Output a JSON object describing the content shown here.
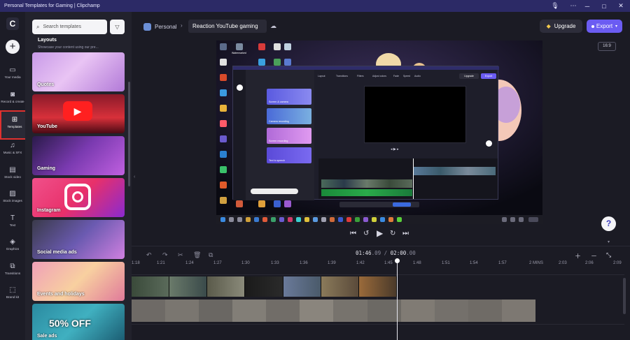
{
  "window": {
    "title": "Personal Templates for Gaming | Clipchamp",
    "controls": [
      "🎙",
      "⋯",
      "─",
      "□",
      "✕"
    ]
  },
  "nav": {
    "logo_letter": "C",
    "create_symbol": "+",
    "items": [
      {
        "label": "Your media",
        "icon": "folder-icon",
        "glyph": "▭"
      },
      {
        "label": "Record & create",
        "icon": "camera-icon",
        "glyph": "◙"
      },
      {
        "label": "Templates",
        "icon": "templates-icon",
        "glyph": "⊞",
        "active": true
      },
      {
        "label": "Music & SFX",
        "icon": "music-icon",
        "glyph": "♫"
      },
      {
        "label": "Stock video",
        "icon": "film-icon",
        "glyph": "▤"
      },
      {
        "label": "Stock images",
        "icon": "image-icon",
        "glyph": "▨"
      },
      {
        "label": "Text",
        "icon": "text-icon",
        "glyph": "T"
      },
      {
        "label": "Graphics",
        "icon": "shapes-icon",
        "glyph": "◈"
      },
      {
        "label": "Transitions",
        "icon": "transitions-icon",
        "glyph": "⧉"
      },
      {
        "label": "Brand kit",
        "icon": "brand-kit-icon",
        "glyph": "⬚"
      }
    ]
  },
  "templates_panel": {
    "search_placeholder": "Search templates",
    "section_title": "Layouts",
    "section_subtitle": "Showcase your content using our pre...",
    "cards": [
      {
        "label": "Quotes"
      },
      {
        "label": "YouTube"
      },
      {
        "label": "Gaming"
      },
      {
        "label": "Instagram"
      },
      {
        "label": "Social media ads"
      },
      {
        "label": "Events and holidays"
      },
      {
        "label": "Sale ads",
        "overlay_text": "50% OFF"
      }
    ]
  },
  "header": {
    "workspace": "Personal",
    "project_name": "Reaction YouTube gaming",
    "upgrade_label": "Upgrade",
    "export_label": "Export",
    "aspect_ratio": "16:9"
  },
  "preview": {
    "inner_watermark": "Watermarked",
    "inner_upgrade": "Upgrade",
    "inner_export": "Export",
    "inner_tabs": [
      "Layout",
      "Transitions",
      "Filters",
      "Adjust colors",
      "Fade",
      "Speed",
      "Audio"
    ],
    "inner_templates": [
      "Screen & camera",
      "Camera recording",
      "Screen recording",
      "Text to speech"
    ]
  },
  "timeline": {
    "current_time": "01:46",
    "current_frames": ".09",
    "total_time": "02:00",
    "total_frames": ".00",
    "ruler_ticks": [
      "1:18",
      "1:21",
      "1:24",
      "1:27",
      "1:30",
      "1:33",
      "1:36",
      "1:39",
      "1:42",
      "1:45",
      "1:48",
      "1:51",
      "1:54",
      "1:57",
      "2 MINS",
      "2:03",
      "2:06",
      "2:09"
    ]
  }
}
